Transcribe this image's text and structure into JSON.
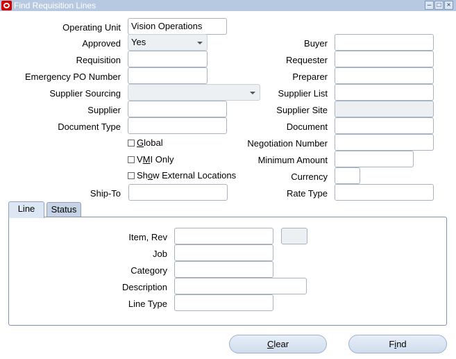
{
  "window": {
    "title": "Find Requisition Lines",
    "min_icon": "minimize-icon",
    "max_icon": "maximize-icon",
    "close_icon": "close-icon"
  },
  "left": {
    "operating_unit": {
      "label": "Operating Unit",
      "value": "Vision Operations"
    },
    "approved": {
      "label": "Approved",
      "value": "Yes"
    },
    "requisition": {
      "label": "Requisition",
      "value": ""
    },
    "emergency_po": {
      "label": "Emergency PO Number",
      "value": ""
    },
    "supplier_sourcing": {
      "label": "Supplier Sourcing",
      "value": ""
    },
    "supplier": {
      "label": "Supplier",
      "value": ""
    },
    "document_type": {
      "label": "Document Type",
      "value": ""
    },
    "global": {
      "pre": "",
      "mn": "G",
      "post": "lobal"
    },
    "vmi_only": {
      "pre": "V",
      "mn": "M",
      "post": "I Only"
    },
    "show_external": {
      "pre": "Sh",
      "mn": "o",
      "post": "w External Locations"
    },
    "ship_to": {
      "label": "Ship-To",
      "value": ""
    }
  },
  "right": {
    "buyer": {
      "label": "Buyer",
      "value": ""
    },
    "requester": {
      "label": "Requester",
      "value": ""
    },
    "preparer": {
      "label": "Preparer",
      "value": ""
    },
    "supplier_list": {
      "label": "Supplier List",
      "value": ""
    },
    "supplier_site": {
      "label": "Supplier Site",
      "value": ""
    },
    "document": {
      "label": "Document",
      "value": ""
    },
    "negotiation_number": {
      "label": "Negotiation Number",
      "value": ""
    },
    "minimum_amount": {
      "label": "Minimum Amount",
      "value": ""
    },
    "currency": {
      "label": "Currency",
      "value": ""
    },
    "rate_type": {
      "label": "Rate Type",
      "value": ""
    }
  },
  "tabs": {
    "line": "Line",
    "status": "Status"
  },
  "line_tab": {
    "item_rev": {
      "label": "Item, Rev",
      "value": ""
    },
    "job": {
      "label": "Job",
      "value": ""
    },
    "category": {
      "label": "Category",
      "value": ""
    },
    "description": {
      "label": "Description",
      "value": ""
    },
    "line_type": {
      "label": "Line Type",
      "value": ""
    }
  },
  "buttons": {
    "clear": {
      "mn": "C",
      "rest": "lear"
    },
    "find": {
      "pre": "F",
      "mn": "i",
      "post": "nd"
    }
  }
}
